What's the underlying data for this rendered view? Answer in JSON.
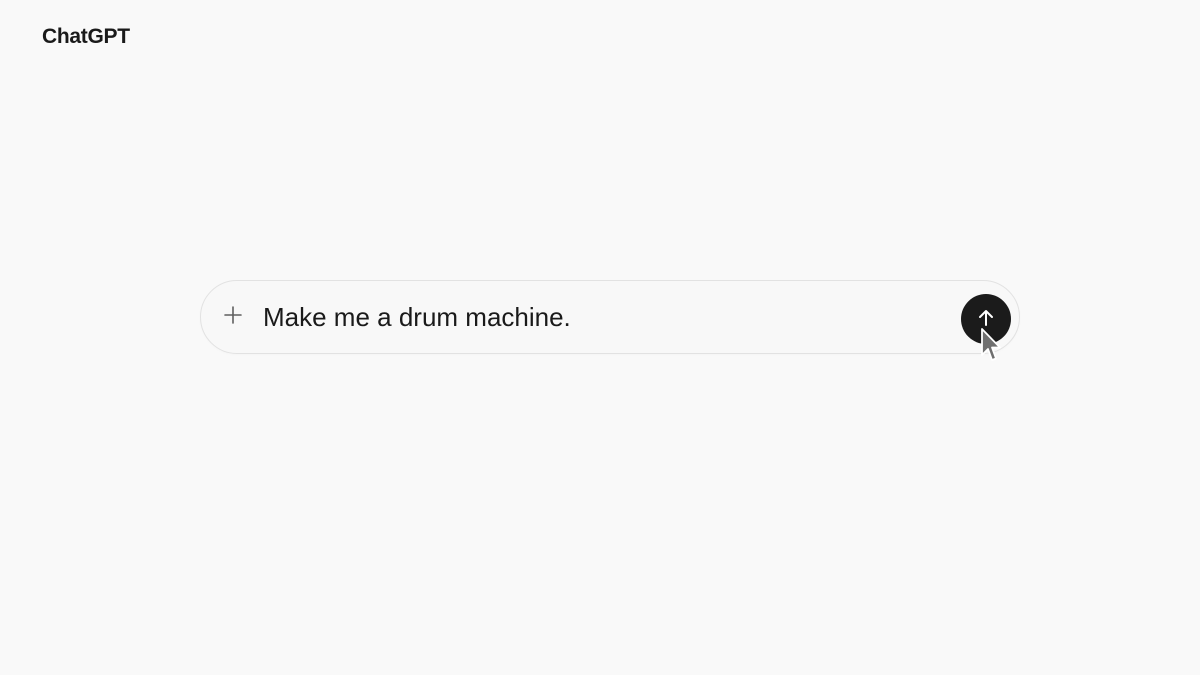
{
  "header": {
    "app_title": "ChatGPT"
  },
  "composer": {
    "input_value": "Make me a drum machine.",
    "plus_icon": "plus-icon",
    "send_icon": "arrow-up-icon"
  },
  "colors": {
    "background": "#f9f9f9",
    "send_button": "#1b1b1b",
    "text": "#1a1a1a"
  }
}
